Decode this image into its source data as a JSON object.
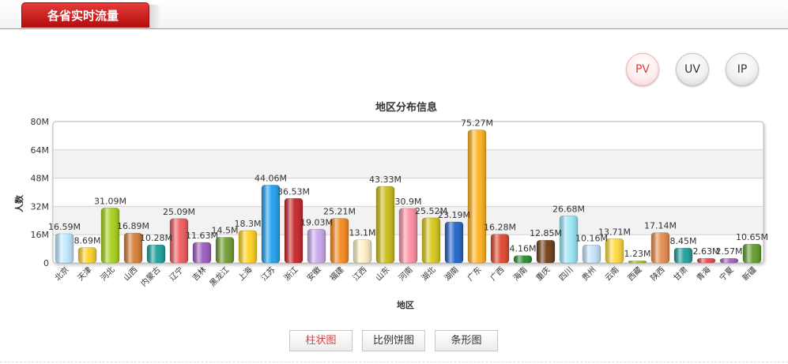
{
  "header": {
    "tab_label": "各省实时流量"
  },
  "metric_buttons": [
    "PV",
    "UV",
    "IP"
  ],
  "view_buttons": [
    "柱状图",
    "比例饼图",
    "条形图"
  ],
  "colors": {
    "accent": "#d01f1f",
    "active_text": "#e33b3b"
  },
  "chart_data": {
    "type": "bar",
    "title": "地区分布信息",
    "xlabel": "地区",
    "ylabel": "人数",
    "ylim": [
      0,
      80
    ],
    "y_ticks": [
      "0",
      "16M",
      "32M",
      "48M",
      "64M",
      "80M"
    ],
    "grid": true,
    "categories": [
      "北京",
      "天津",
      "河北",
      "山西",
      "内蒙古",
      "辽宁",
      "吉林",
      "黑龙江",
      "上海",
      "江苏",
      "浙江",
      "安徽",
      "福建",
      "江西",
      "山东",
      "河南",
      "湖北",
      "湖南",
      "广东",
      "广西",
      "海南",
      "重庆",
      "四川",
      "贵州",
      "云南",
      "西藏",
      "陕西",
      "甘肃",
      "青海",
      "宁夏",
      "新疆"
    ],
    "values": [
      16.59,
      8.69,
      31.09,
      16.89,
      10.28,
      25.09,
      11.63,
      14.5,
      18.3,
      44.06,
      36.53,
      19.03,
      25.21,
      13.1,
      43.33,
      30.9,
      25.52,
      23.19,
      75.27,
      16.28,
      4.16,
      12.85,
      26.68,
      10.16,
      13.71,
      1.23,
      17.14,
      8.45,
      2.63,
      2.57,
      10.65
    ],
    "value_labels": [
      "16.59M",
      "8.69M",
      "31.09M",
      "16.89M",
      "10.28M",
      "25.09M",
      "11.63M",
      "14.5M",
      "18.3M",
      "44.06M",
      "36.53M",
      "19.03M",
      "25.21M",
      "13.1M",
      "43.33M",
      "30.9M",
      "25.52M",
      "23.19M",
      "75.27M",
      "16.28M",
      "4.16M",
      "12.85M",
      "26.68M",
      "10.16M",
      "13.71M",
      "1.23M",
      "17.14M",
      "8.45M",
      "2.63M",
      "2.57M",
      "10.65M"
    ],
    "bar_colors": [
      "#bfe9ff",
      "#ffd12b",
      "#a6d11a",
      "#d57b33",
      "#1b9e9a",
      "#f0585b",
      "#9a5bbf",
      "#6d9b2e",
      "#ffd21e",
      "#1ea0f0",
      "#c42227",
      "#c9a8ef",
      "#f58a1f",
      "#fff0c4",
      "#c9bc16",
      "#ff8fa3",
      "#d6c81a",
      "#1d63c9",
      "#ffb21c",
      "#e0442a",
      "#2a8a2e",
      "#6e3b14",
      "#9ce7f7",
      "#c3e4fb",
      "#ffd83a",
      "#a9c226",
      "#e58a4c",
      "#1d9d9a",
      "#e9454d",
      "#a65cc2",
      "#5f9b2b"
    ]
  }
}
